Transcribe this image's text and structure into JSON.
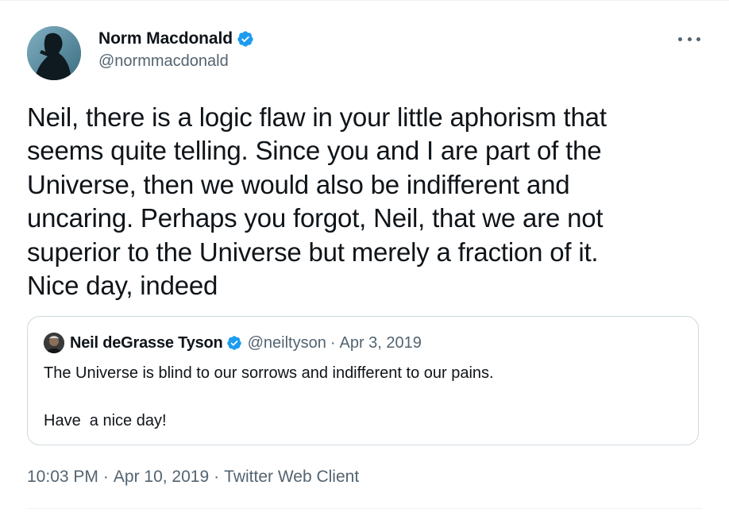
{
  "author": {
    "display_name": "Norm Macdonald",
    "handle": "@normmacdonald",
    "verified": true
  },
  "tweet": {
    "text": "Neil, there is a logic flaw in your little aphorism that\nseems quite telling. Since you and I are part of the\nUniverse, then we would also be indifferent and\nuncaring. Perhaps you forgot, Neil, that we are not\nsuperior to the Universe but merely a fraction of it.\nNice day, indeed"
  },
  "quoted_tweet": {
    "display_name": "Neil deGrasse Tyson",
    "handle": "@neiltyson",
    "separator": "·",
    "date": "Apr 3, 2019",
    "verified": true,
    "text": "The Universe is blind to our sorrows and indifferent to our pains.\n\nHave  a nice day!"
  },
  "meta": {
    "time": "10:03 PM",
    "date": "Apr 10, 2019",
    "source": "Twitter Web Client",
    "separator": "·"
  },
  "icons": {
    "verified": "verified-badge-icon",
    "more": "more-options-icon"
  },
  "colors": {
    "text_primary": "#0f1419",
    "text_secondary": "#536471",
    "verified_blue": "#1d9bf0",
    "border": "#cfd9de"
  }
}
